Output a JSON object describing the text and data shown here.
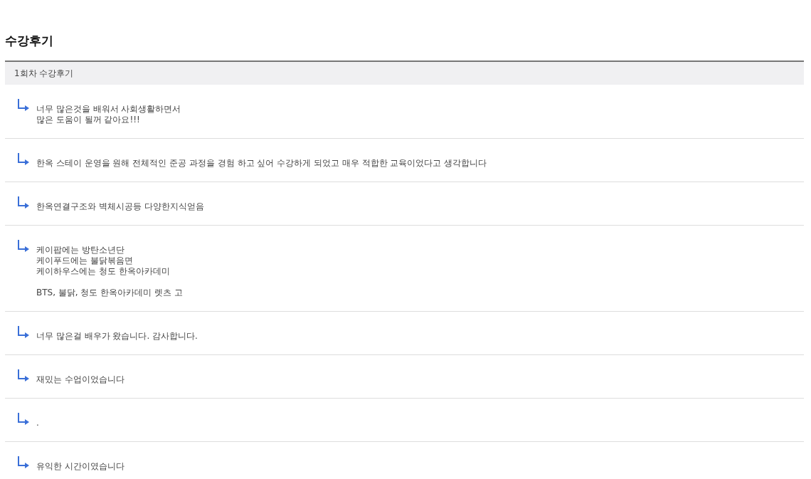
{
  "title": "수강후기",
  "section": {
    "label": "1회차 수강후기"
  },
  "reviews": [
    {
      "text": "너무 많은것을 배워서 사회생활하면서\n많은 도움이 될꺼 같아요!!!"
    },
    {
      "text": "한옥 스테이 운영을 원해 전체적인 준공 과정을 경험 하고 싶어 수강하게 되었고 매우 적합한 교육이었다고 생각합니다"
    },
    {
      "text": "한옥연결구조와 벽체시공등 다양한지식얻음"
    },
    {
      "text": "케이팝에는 방탄소년단\n케이푸드에는 불닭볶음면\n케이하우스에는 청도 한옥아카데미\n\nBTS, 불닭, 청도 한옥아카데미 렛츠 고"
    },
    {
      "text": "너무 많은걸 배우가 왔습니다. 감사합니다."
    },
    {
      "text": "재밌는 수업이었습니다"
    },
    {
      "text": "."
    },
    {
      "text": "유익한 시간이였습니다"
    }
  ]
}
